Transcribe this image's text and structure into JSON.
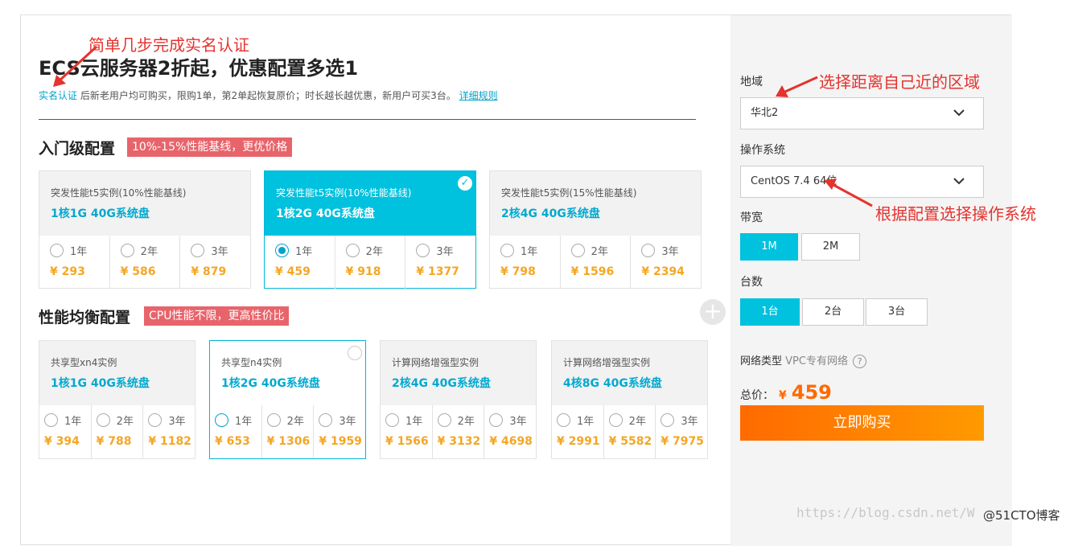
{
  "header": {
    "title": "ECS云服务器2折起，优惠配置多选1",
    "verify_link": "实名认证",
    "description": "后新老用户均可购买，限购1单，第2单起恢复原价；时长越长越优惠，新用户可买3台。",
    "rules_link": "详细规则"
  },
  "entry_section": {
    "title": "入门级配置",
    "tag": "10%-15%性能基线，更优价格",
    "cards": [
      {
        "instance": "突发性能t5实例(10%性能基线)",
        "config": "1核1G 40G系统盘",
        "selected": false,
        "options": [
          {
            "label": "1年",
            "price": "¥ 293"
          },
          {
            "label": "2年",
            "price": "¥ 586"
          },
          {
            "label": "3年",
            "price": "¥ 879"
          }
        ]
      },
      {
        "instance": "突发性能t5实例(10%性能基线)",
        "config": "1核2G 40G系统盘",
        "selected": true,
        "options": [
          {
            "label": "1年",
            "price": "¥ 459"
          },
          {
            "label": "2年",
            "price": "¥ 918"
          },
          {
            "label": "3年",
            "price": "¥ 1377"
          }
        ]
      },
      {
        "instance": "突发性能t5实例(15%性能基线)",
        "config": "2核4G 40G系统盘",
        "selected": false,
        "options": [
          {
            "label": "1年",
            "price": "¥ 798"
          },
          {
            "label": "2年",
            "price": "¥ 1596"
          },
          {
            "label": "3年",
            "price": "¥ 2394"
          }
        ]
      }
    ]
  },
  "balanced_section": {
    "title": "性能均衡配置",
    "tag": "CPU性能不限，更高性价比",
    "cards": [
      {
        "instance": "共享型xn4实例",
        "config": "1核1G 40G系统盘",
        "options": [
          {
            "label": "1年",
            "price": "¥ 394"
          },
          {
            "label": "2年",
            "price": "¥ 788"
          },
          {
            "label": "3年",
            "price": "¥ 1182"
          }
        ]
      },
      {
        "instance": "共享型n4实例",
        "config": "1核2G 40G系统盘",
        "options": [
          {
            "label": "1年",
            "price": "¥ 653"
          },
          {
            "label": "2年",
            "price": "¥ 1306"
          },
          {
            "label": "3年",
            "price": "¥ 1959"
          }
        ]
      },
      {
        "instance": "计算网络增强型实例",
        "config": "2核4G 40G系统盘",
        "options": [
          {
            "label": "1年",
            "price": "¥ 1566"
          },
          {
            "label": "2年",
            "price": "¥ 3132"
          },
          {
            "label": "3年",
            "price": "¥ 4698"
          }
        ]
      },
      {
        "instance": "计算网络增强型实例",
        "config": "4核8G 40G系统盘",
        "options": [
          {
            "label": "1年",
            "price": "¥ 2991"
          },
          {
            "label": "2年",
            "price": "¥ 5582"
          },
          {
            "label": "3年",
            "price": "¥ 7975"
          }
        ]
      }
    ]
  },
  "order_panel": {
    "region_label": "地域",
    "region_value": "华北2",
    "os_label": "操作系统",
    "os_value": "CentOS 7.4 64位",
    "bandwidth_label": "带宽",
    "bandwidth_options": [
      "1M",
      "2M"
    ],
    "count_label": "台数",
    "count_options": [
      "1台",
      "2台",
      "3台"
    ],
    "network_label": "网络类型",
    "network_value": "VPC专有网络",
    "help": "?",
    "total_label": "总价：",
    "currency": "¥",
    "total_amount": "459",
    "buy_label": "立即购买"
  },
  "annotations": {
    "a1": "简单几步完成实名认证",
    "a2": "选择距离自己近的区域",
    "a3": "根据配置选择操作系统"
  },
  "watermark": {
    "url": "https://blog.csdn.net/W",
    "site": "@51CTO博客"
  },
  "colors": {
    "accent": "#00c1de",
    "price": "#f5a623",
    "buy": "#ff6a00",
    "tag": "#e8646b",
    "annotation": "#e5332e"
  }
}
